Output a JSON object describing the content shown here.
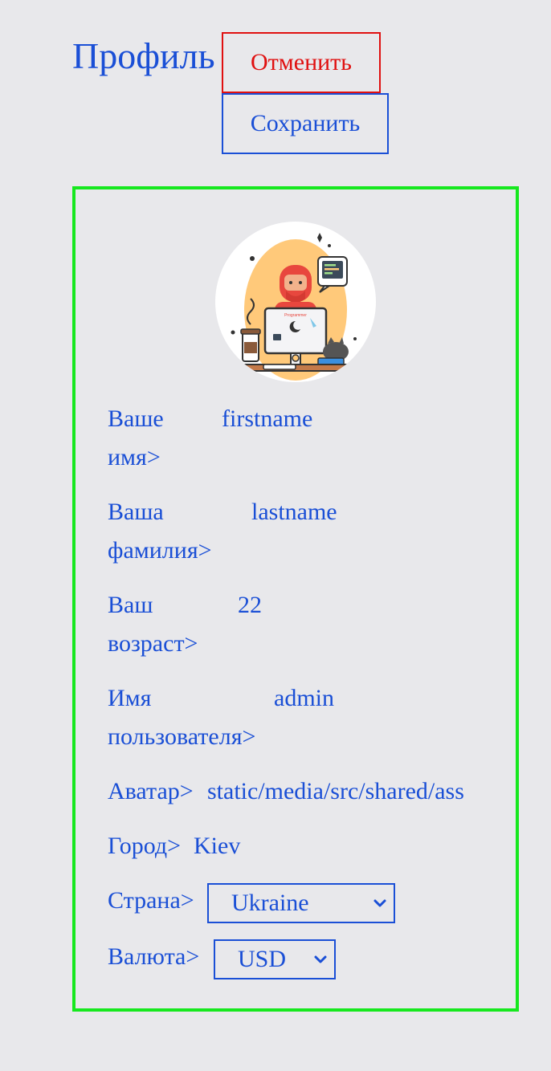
{
  "header": {
    "title": "Профиль",
    "cancel_label": "Отменить",
    "save_label": "Сохранить"
  },
  "profile": {
    "firstname": {
      "label": "Ваше имя>",
      "label_line1": "Ваше",
      "label_line2": "имя>",
      "value": "firstname"
    },
    "lastname": {
      "label_line1": "Ваша",
      "label_line2": "фамилия>",
      "value": "lastname"
    },
    "age": {
      "label_line1": "Ваш",
      "label_line2": "возраст>",
      "value": "22"
    },
    "username": {
      "label_line1": "Имя",
      "label_line2": "пользователя>",
      "value": "admin"
    },
    "avatar": {
      "label": "Аватар>",
      "value": "static/media/src/shared/ass"
    },
    "city": {
      "label": "Город>",
      "value": "Kiev"
    },
    "country": {
      "label": "Страна>",
      "selected": "Ukraine"
    },
    "currency": {
      "label": "Валюта>",
      "selected": "USD"
    }
  },
  "icons": {
    "avatar_image": "developer-at-computer-illustration",
    "dropdown": "chevron-down-icon"
  },
  "colors": {
    "primary": "#1a4fd6",
    "danger": "#e01010",
    "card_border": "#16e81e",
    "background": "#e8e8eb"
  }
}
